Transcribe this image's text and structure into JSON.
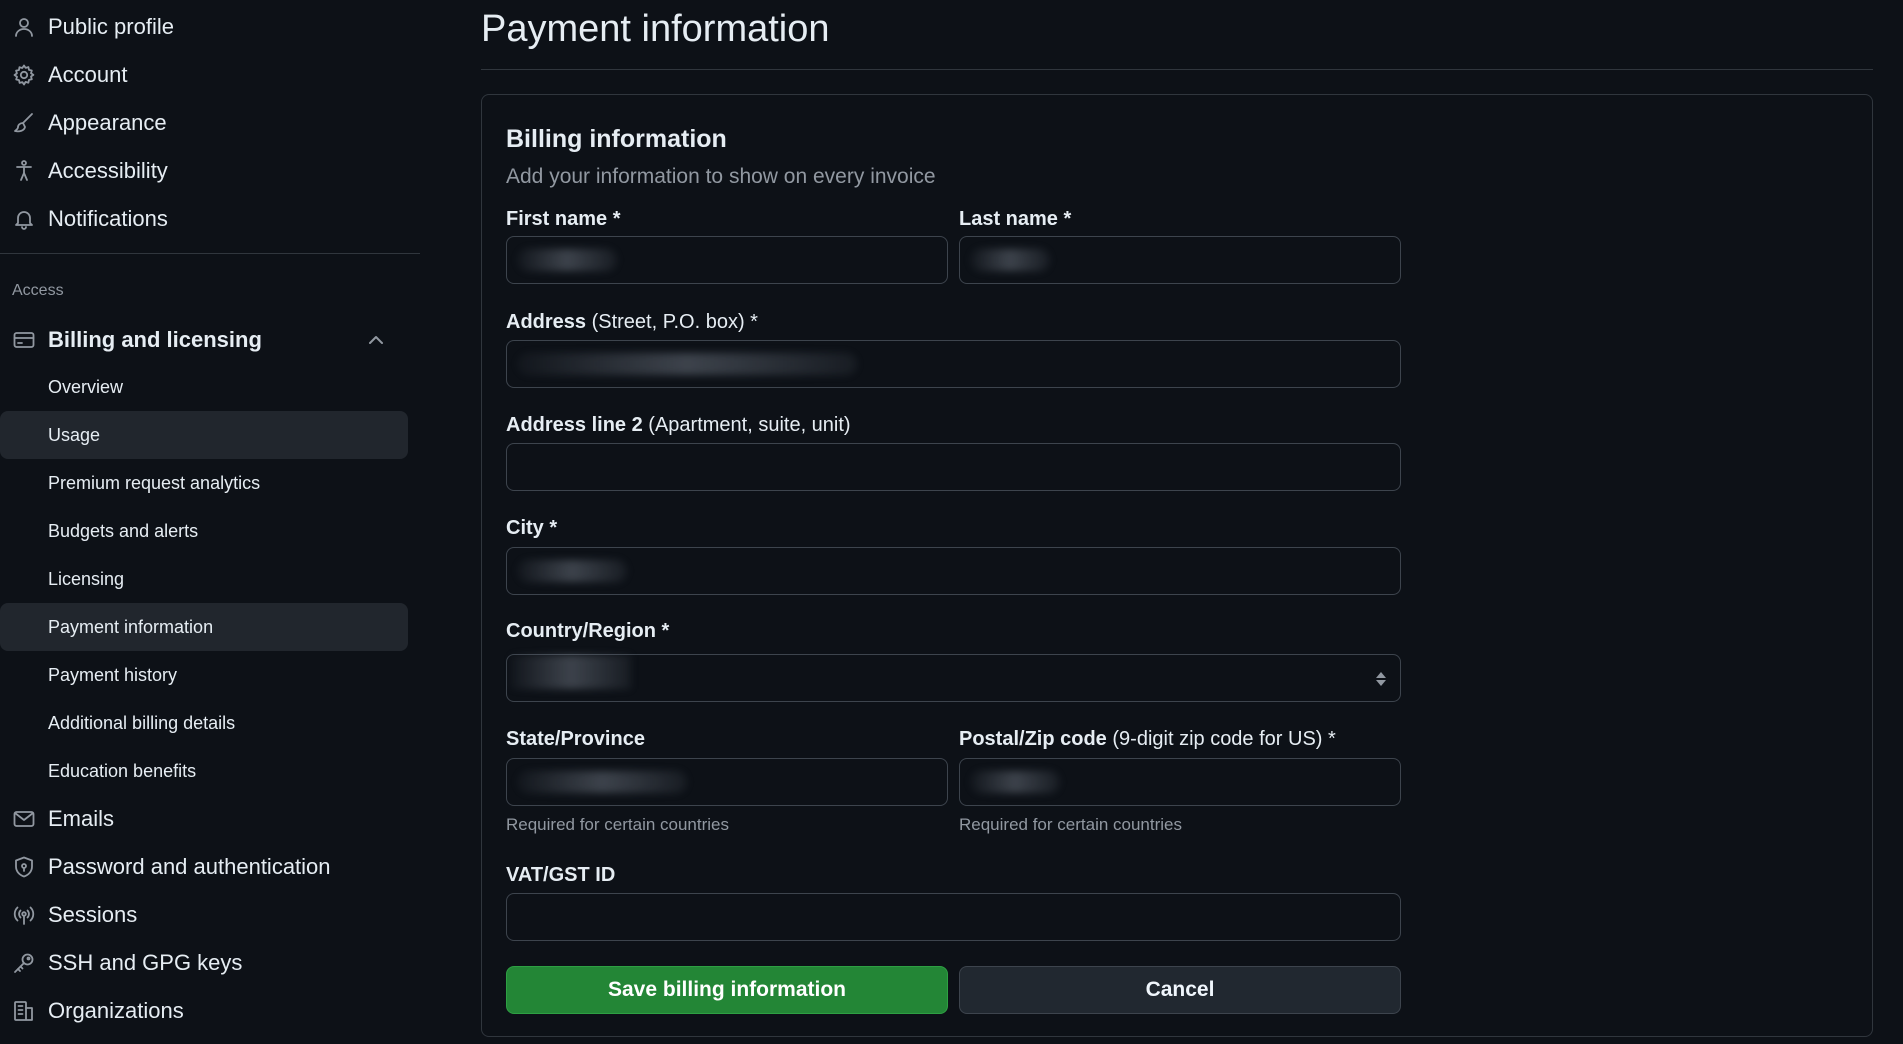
{
  "sidebar": {
    "top_items": [
      {
        "label": "Public profile",
        "icon": "person-icon"
      },
      {
        "label": "Account",
        "icon": "gear-icon"
      },
      {
        "label": "Appearance",
        "icon": "paintbrush-icon"
      },
      {
        "label": "Accessibility",
        "icon": "accessibility-icon"
      },
      {
        "label": "Notifications",
        "icon": "bell-icon"
      }
    ],
    "section_heading": "Access",
    "billing": {
      "label": "Billing and licensing",
      "icon": "credit-card-icon",
      "expanded": true,
      "children": [
        {
          "label": "Overview"
        },
        {
          "label": "Usage"
        },
        {
          "label": "Premium request analytics"
        },
        {
          "label": "Budgets and alerts"
        },
        {
          "label": "Licensing"
        },
        {
          "label": "Payment information"
        },
        {
          "label": "Payment history"
        },
        {
          "label": "Additional billing details"
        },
        {
          "label": "Education benefits"
        }
      ]
    },
    "bottom_items": [
      {
        "label": "Emails",
        "icon": "mail-icon"
      },
      {
        "label": "Password and authentication",
        "icon": "shield-lock-icon"
      },
      {
        "label": "Sessions",
        "icon": "broadcast-icon"
      },
      {
        "label": "SSH and GPG keys",
        "icon": "key-icon"
      },
      {
        "label": "Organizations",
        "icon": "organization-icon"
      }
    ]
  },
  "page": {
    "title": "Payment information"
  },
  "billing_form": {
    "title": "Billing information",
    "subtitle": "Add your information to show on every invoice",
    "first_name": {
      "label": "First name *"
    },
    "last_name": {
      "label": "Last name *"
    },
    "address": {
      "label": "Address",
      "note": "(Street, P.O. box) *"
    },
    "address2": {
      "label": "Address line 2",
      "note": "(Apartment, suite, unit)"
    },
    "city": {
      "label": "City *"
    },
    "country": {
      "label": "Country/Region *"
    },
    "state": {
      "label": "State/Province",
      "hint": "Required for certain countries"
    },
    "postal": {
      "label": "Postal/Zip code",
      "note": "(9-digit zip code for US) *",
      "hint": "Required for certain countries"
    },
    "vat": {
      "label": "VAT/GST ID"
    },
    "save_label": "Save billing information",
    "cancel_label": "Cancel"
  },
  "colors": {
    "background": "#0d1117",
    "primary_button": "#238636",
    "active_nav": "#21262d",
    "border": "#30363d"
  }
}
